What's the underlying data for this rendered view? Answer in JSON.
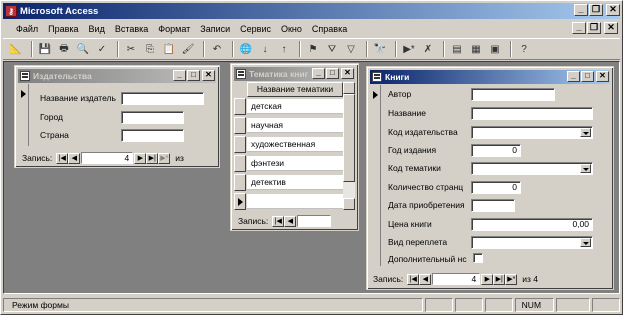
{
  "app": {
    "title": "Microsoft Access"
  },
  "menu": [
    "Файл",
    "Правка",
    "Вид",
    "Вставка",
    "Формат",
    "Записи",
    "Сервис",
    "Окно",
    "Справка"
  ],
  "toolbar": {
    "icons": [
      "design-view-icon",
      "save-icon",
      "print-icon",
      "print-preview-icon",
      "spell-check-icon",
      "cut-icon",
      "copy-icon",
      "paste-icon",
      "format-painter-icon",
      "undo-icon",
      "hyperlink-icon",
      "sort-ascending-icon",
      "sort-descending-icon",
      "filter-by-selection-icon",
      "filter-by-form-icon",
      "apply-filter-icon",
      "find-icon",
      "new-record-icon",
      "delete-record-icon",
      "properties-icon",
      "database-window-icon",
      "new-object-icon",
      "help-icon"
    ]
  },
  "publisher_form": {
    "title": "Издательства",
    "labels": {
      "name": "Название издатель",
      "city": "Город",
      "country": "Страна"
    },
    "values": {
      "name": "",
      "city": "",
      "country": ""
    },
    "nav": {
      "label": "Запись:",
      "current": "4",
      "of": "из"
    }
  },
  "topics_form": {
    "title": "Тематика книг",
    "column": "Название тематики",
    "rows": [
      "детская",
      "научная",
      "художественная",
      "фэнтези",
      "детектив"
    ],
    "nav": {
      "label": "Запись:"
    }
  },
  "books_form": {
    "title": "Книги",
    "labels": {
      "author": "Автор",
      "name": "Название",
      "publisher_code": "Код издательства",
      "year": "Год издания",
      "topic_code": "Код тематики",
      "pages": "Количество странц",
      "purchase_date": "Дата приобретения",
      "price": "Цена книги",
      "binding": "Вид переплета",
      "extra": "Дополнительный нс"
    },
    "values": {
      "author": "",
      "name": "",
      "publisher_code": "",
      "year": "0",
      "topic_code": "",
      "pages": "0",
      "purchase_date": "",
      "price": "0,00",
      "binding": ""
    },
    "nav": {
      "label": "Запись:",
      "current": "4",
      "of": "из 4"
    }
  },
  "status": {
    "mode": "Режим формы",
    "num": "NUM"
  }
}
